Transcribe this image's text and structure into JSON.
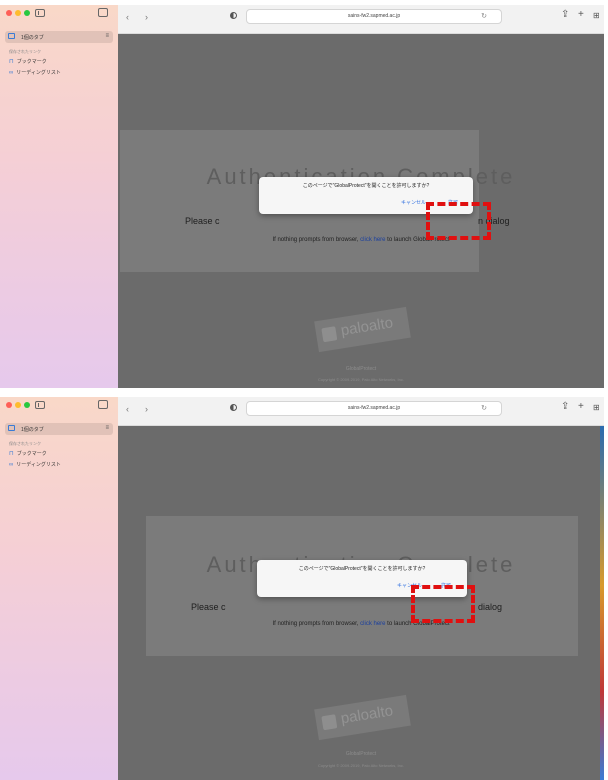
{
  "sidebar": {
    "tab_group": "1個のタブ",
    "section_title": "保存されたリンク",
    "items": [
      {
        "label": "ブックマーク",
        "icon": "bookmark-icon"
      },
      {
        "label": "リーディングリスト",
        "icon": "glasses-icon"
      }
    ]
  },
  "browser": {
    "url": "sains-fw2.sapmed.ac.jp",
    "back": "‹",
    "forward": "›"
  },
  "page": {
    "title": "Authentication Complete",
    "line_left": "Please c",
    "line_right_1": "n dialog",
    "line_right_2": "dialog",
    "sub_before": "If nothing prompts from browser, ",
    "sub_link": "click here",
    "sub_after": " to launch GlobalProtect",
    "logo": "paloalto",
    "footer_product": "GlobalProtect",
    "footer_copyright": "Copyright © 2009-2019, Palo Alto Networks, Inc."
  },
  "dialog": {
    "message": "このページで\"GlobalProtect\"を開くことを許可しますか?",
    "cancel_label": "キャンセル",
    "allow_label": "許可"
  },
  "colors": {
    "accent": "#2f6fe0",
    "highlight": "#e01010",
    "page_bg": "#6b6b6b"
  }
}
